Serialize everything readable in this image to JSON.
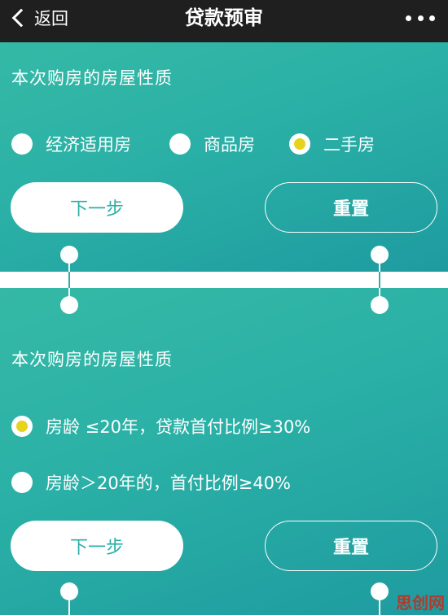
{
  "header": {
    "back_label": "返回",
    "title": "贷款预审"
  },
  "section1": {
    "question": "本次购房的房屋性质",
    "options": [
      {
        "label": "经济适用房",
        "selected": false
      },
      {
        "label": "商品房",
        "selected": false
      },
      {
        "label": "二手房",
        "selected": true
      }
    ],
    "next_label": "下一步",
    "reset_label": "重置"
  },
  "section2": {
    "question": "本次购房的房屋性质",
    "options": [
      {
        "label": "房龄 ≤20年，贷款首付比例≥30%",
        "selected": true
      },
      {
        "label": "房龄＞20年的，首付比例≥40%",
        "selected": false
      }
    ],
    "next_label": "下一步",
    "reset_label": "重置"
  },
  "watermark": "思创网",
  "colors": {
    "teal_start": "#35b9a6",
    "teal_end": "#1e9ba0",
    "selected_dot": "#e8d31c",
    "header_bg": "#1f1f1f"
  }
}
